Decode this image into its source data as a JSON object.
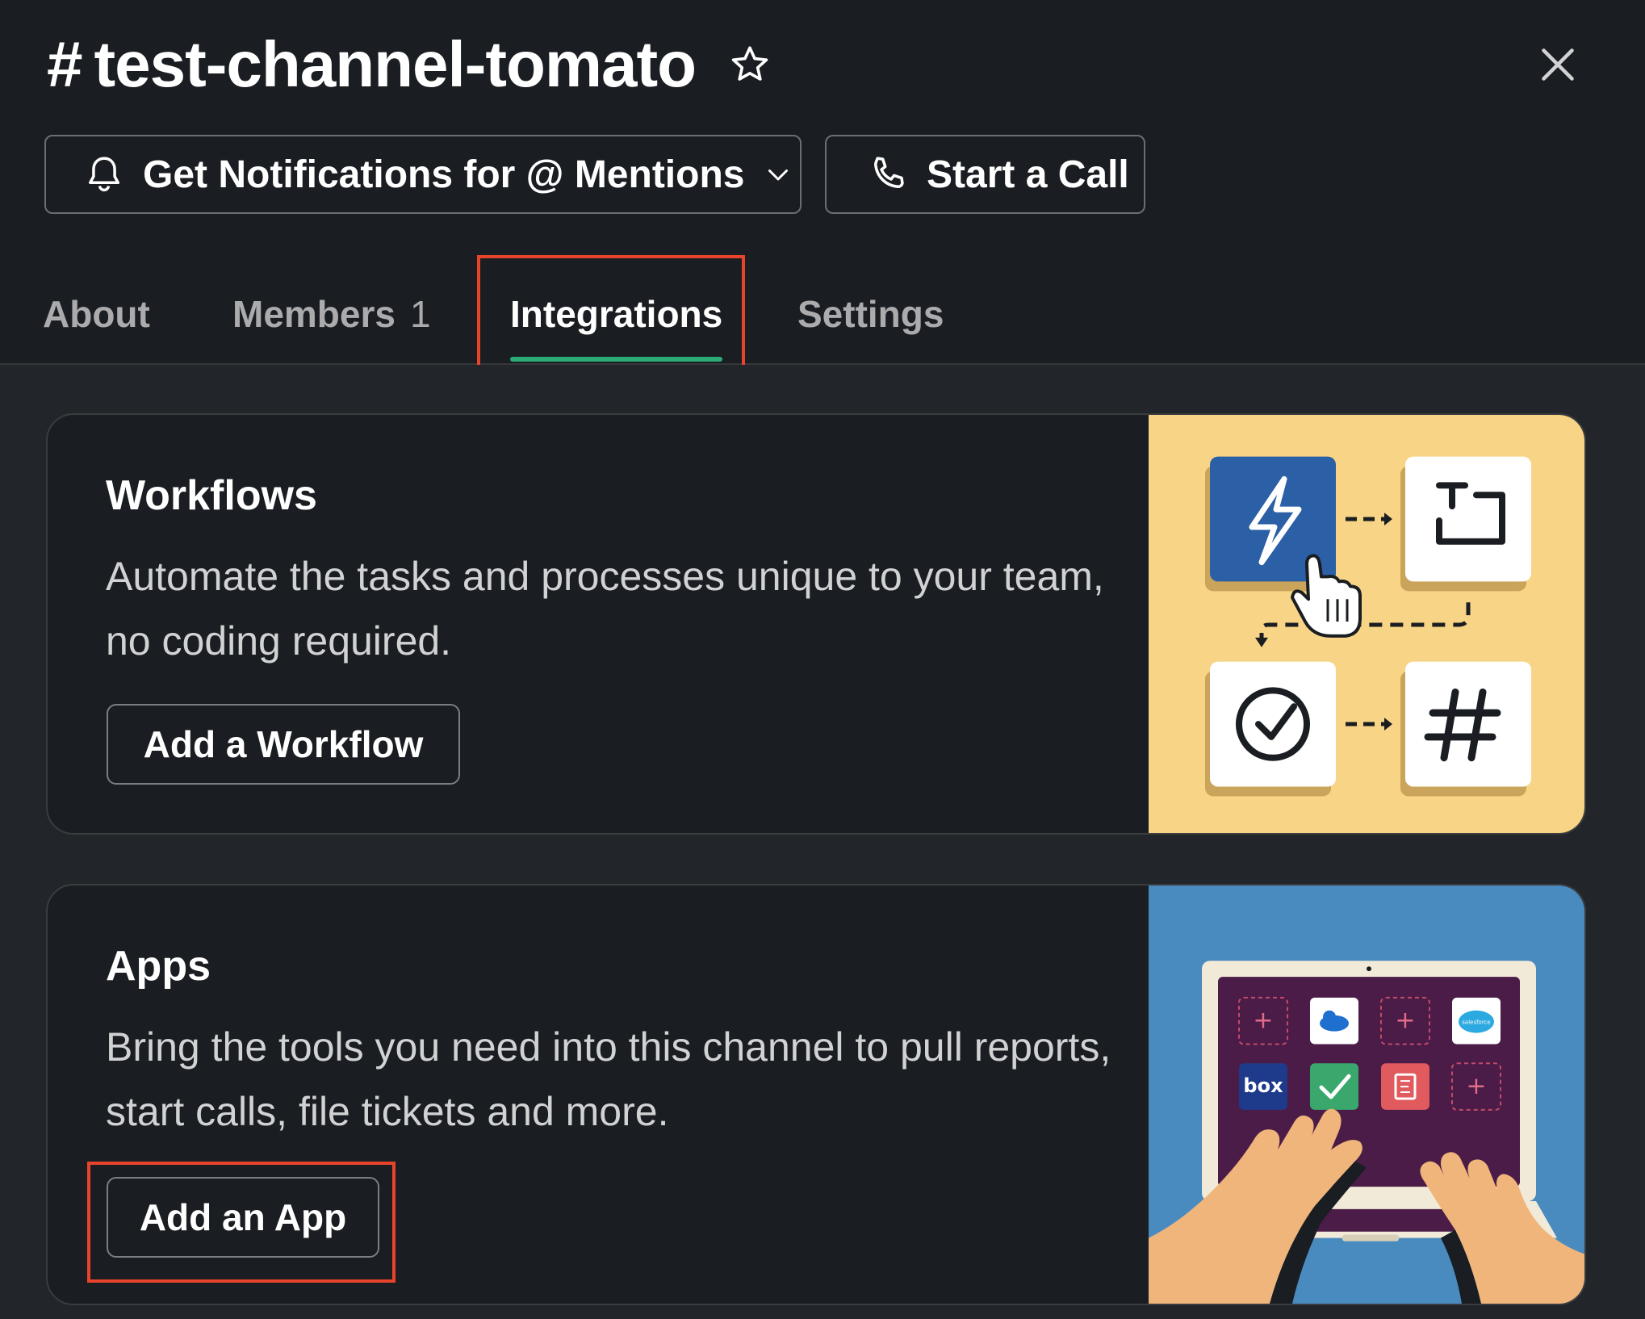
{
  "header": {
    "hash": "#",
    "channel_name": "test-channel-tomato",
    "notifications_label": "Get Notifications for @ Mentions",
    "call_label": "Start a Call"
  },
  "tabs": [
    {
      "label": "About"
    },
    {
      "label": "Members",
      "count": "1"
    },
    {
      "label": "Integrations",
      "active": true
    },
    {
      "label": "Settings"
    }
  ],
  "cards": {
    "workflows": {
      "title": "Workflows",
      "description": "Automate the tasks and processes unique to your team, no coding required.",
      "button_label": "Add a Workflow"
    },
    "apps": {
      "title": "Apps",
      "description": "Bring the tools you need into this channel to pull reports, start calls, file tickets and more.",
      "button_label": "Add an App",
      "app_tile_box": "box",
      "app_tile_salesforce": "salesforce"
    }
  },
  "colors": {
    "background": "#1a1d21",
    "tab_underline": "#2bac76",
    "highlight": "#e8442b",
    "workflow_illustration_bg": "#f8d487",
    "apps_illustration_bg": "#4a8bbf"
  },
  "icons": {
    "star": "star-icon",
    "close": "close-icon",
    "bell": "bell-icon",
    "chevron": "chevron-down-icon",
    "phone": "phone-icon"
  }
}
